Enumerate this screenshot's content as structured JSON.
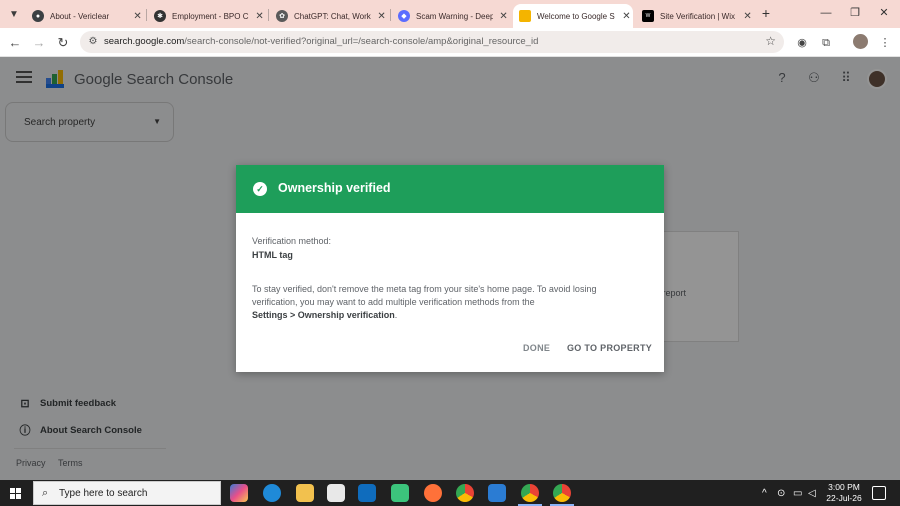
{
  "browser": {
    "tabs": [
      {
        "label": "About - Vericlear",
        "color": "#3c4043",
        "active": false
      },
      {
        "label": "Employment - BPO C",
        "color": "#333333",
        "active": false
      },
      {
        "label": "ChatGPT: Chat, Work",
        "color": "#5a5a5a",
        "active": false
      },
      {
        "label": "Scam Warning - Deep",
        "color": "#5b6cff",
        "active": false
      },
      {
        "label": "Welcome to Google S",
        "color": "#f4b400",
        "active": true
      },
      {
        "label": "Site Verification | Wix",
        "color": "#000000",
        "active": false
      }
    ],
    "tab_close": "✕",
    "new_tab": "+",
    "url_main": "search.google.com",
    "url_rest": "/search-console/not-verified?original_url=/search-console/amp&original_resource_id"
  },
  "header": {
    "title": "Google Search Console"
  },
  "property_select": {
    "placeholder": "Search property"
  },
  "background_card": {
    "text_fragment": "ur report"
  },
  "sidebar": {
    "links": [
      {
        "label": "Submit feedback",
        "icon": "feedback-icon"
      },
      {
        "label": "About Search Console",
        "icon": "info-icon"
      }
    ],
    "footer": {
      "privacy": "Privacy",
      "terms": "Terms"
    }
  },
  "dialog": {
    "title": "Ownership verified",
    "method_label": "Verification method:",
    "method_value": "HTML tag",
    "body_text": "To stay verified, don't remove the meta tag from your site's home page. To avoid losing verification, you may want to add multiple verification methods from the",
    "settings_path": "Settings > Ownership verification",
    "settings_suffix": ".",
    "done_label": "DONE",
    "go_label": "GO TO PROPERTY",
    "header_color": "#1e9e5a"
  },
  "taskbar": {
    "search_placeholder": "Type here to search",
    "time": "3:00 PM",
    "date": "22-Jul-26"
  }
}
